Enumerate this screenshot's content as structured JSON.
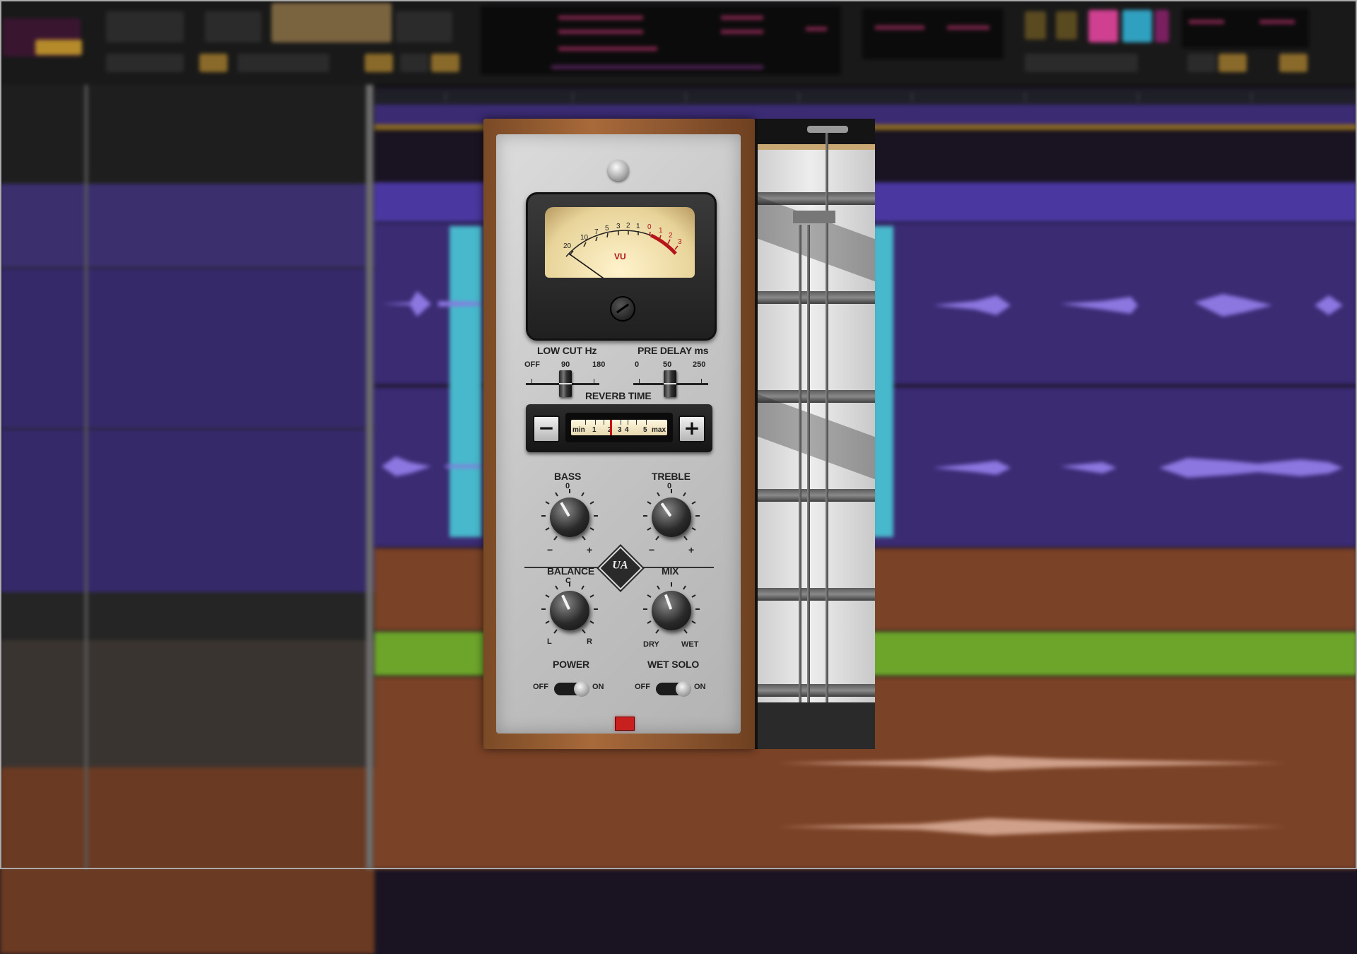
{
  "plugin": {
    "vu": {
      "label": "VU",
      "scale": [
        "20",
        "10",
        "7",
        "5",
        "3",
        "2",
        "1",
        "0",
        "1",
        "2",
        "3"
      ]
    },
    "low_cut": {
      "label": "LOW CUT Hz",
      "ticks": [
        "OFF",
        "90",
        "180"
      ],
      "position": 0.55
    },
    "pre_delay": {
      "label": "PRE DELAY ms",
      "ticks": [
        "0",
        "50",
        "250"
      ],
      "position": 0.5
    },
    "reverb_time": {
      "label": "REVERB TIME",
      "minus": "−",
      "plus": "+",
      "scale": [
        "min",
        "1",
        "2",
        "3",
        "4",
        "5",
        "max"
      ],
      "position": 0.4
    },
    "bass": {
      "label": "BASS",
      "center": "0",
      "minus": "−",
      "plus": "+"
    },
    "treble": {
      "label": "TREBLE",
      "center": "0",
      "minus": "−",
      "plus": "+"
    },
    "logo": "UA",
    "balance": {
      "label": "BALANCE",
      "center": "C",
      "left": "L",
      "right": "R"
    },
    "mix": {
      "label": "MIX",
      "left": "DRY",
      "right": "WET"
    },
    "power": {
      "label": "POWER",
      "off": "OFF",
      "on": "ON",
      "state": "on"
    },
    "wet_solo": {
      "label": "WET SOLO",
      "off": "OFF",
      "on": "ON",
      "state": "on"
    }
  },
  "colors": {
    "lane_purple": "#3a2b73",
    "lane_purple_light": "#4a38a0",
    "lane_brown": "#7a4226",
    "lane_green": "#6da52b",
    "clip_cyan": "#48b8cc",
    "led_red": "#c8201e"
  }
}
